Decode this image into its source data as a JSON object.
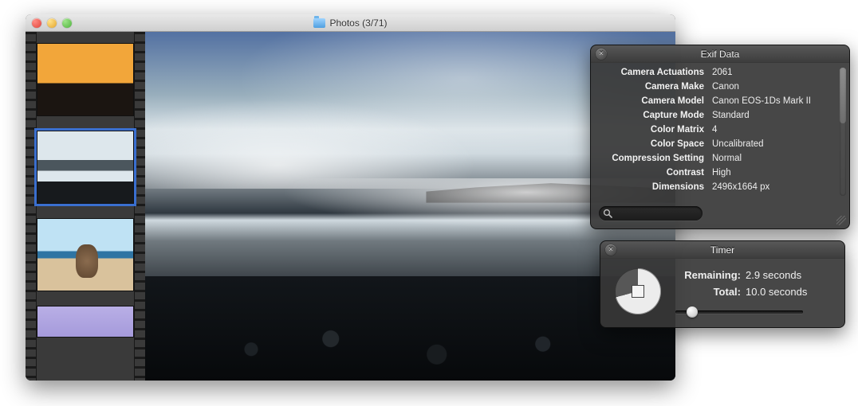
{
  "window": {
    "title": "Photos (3/71)"
  },
  "exif": {
    "panel_title": "Exif Data",
    "rows": [
      {
        "label": "Camera Actuations",
        "value": "2061"
      },
      {
        "label": "Camera Make",
        "value": "Canon"
      },
      {
        "label": "Camera Model",
        "value": "Canon EOS-1Ds Mark II"
      },
      {
        "label": "Capture Mode",
        "value": "Standard"
      },
      {
        "label": "Color Matrix",
        "value": "4"
      },
      {
        "label": "Color Space",
        "value": "Uncalibrated"
      },
      {
        "label": "Compression Setting",
        "value": "Normal"
      },
      {
        "label": "Contrast",
        "value": "High"
      },
      {
        "label": "Dimensions",
        "value": "2496x1664 px"
      }
    ],
    "search_placeholder": ""
  },
  "timer": {
    "panel_title": "Timer",
    "remaining_label": "Remaining:",
    "remaining_value": "2.9 seconds",
    "total_label": "Total:",
    "total_value": "10.0 seconds",
    "progress_fraction": 0.71
  }
}
